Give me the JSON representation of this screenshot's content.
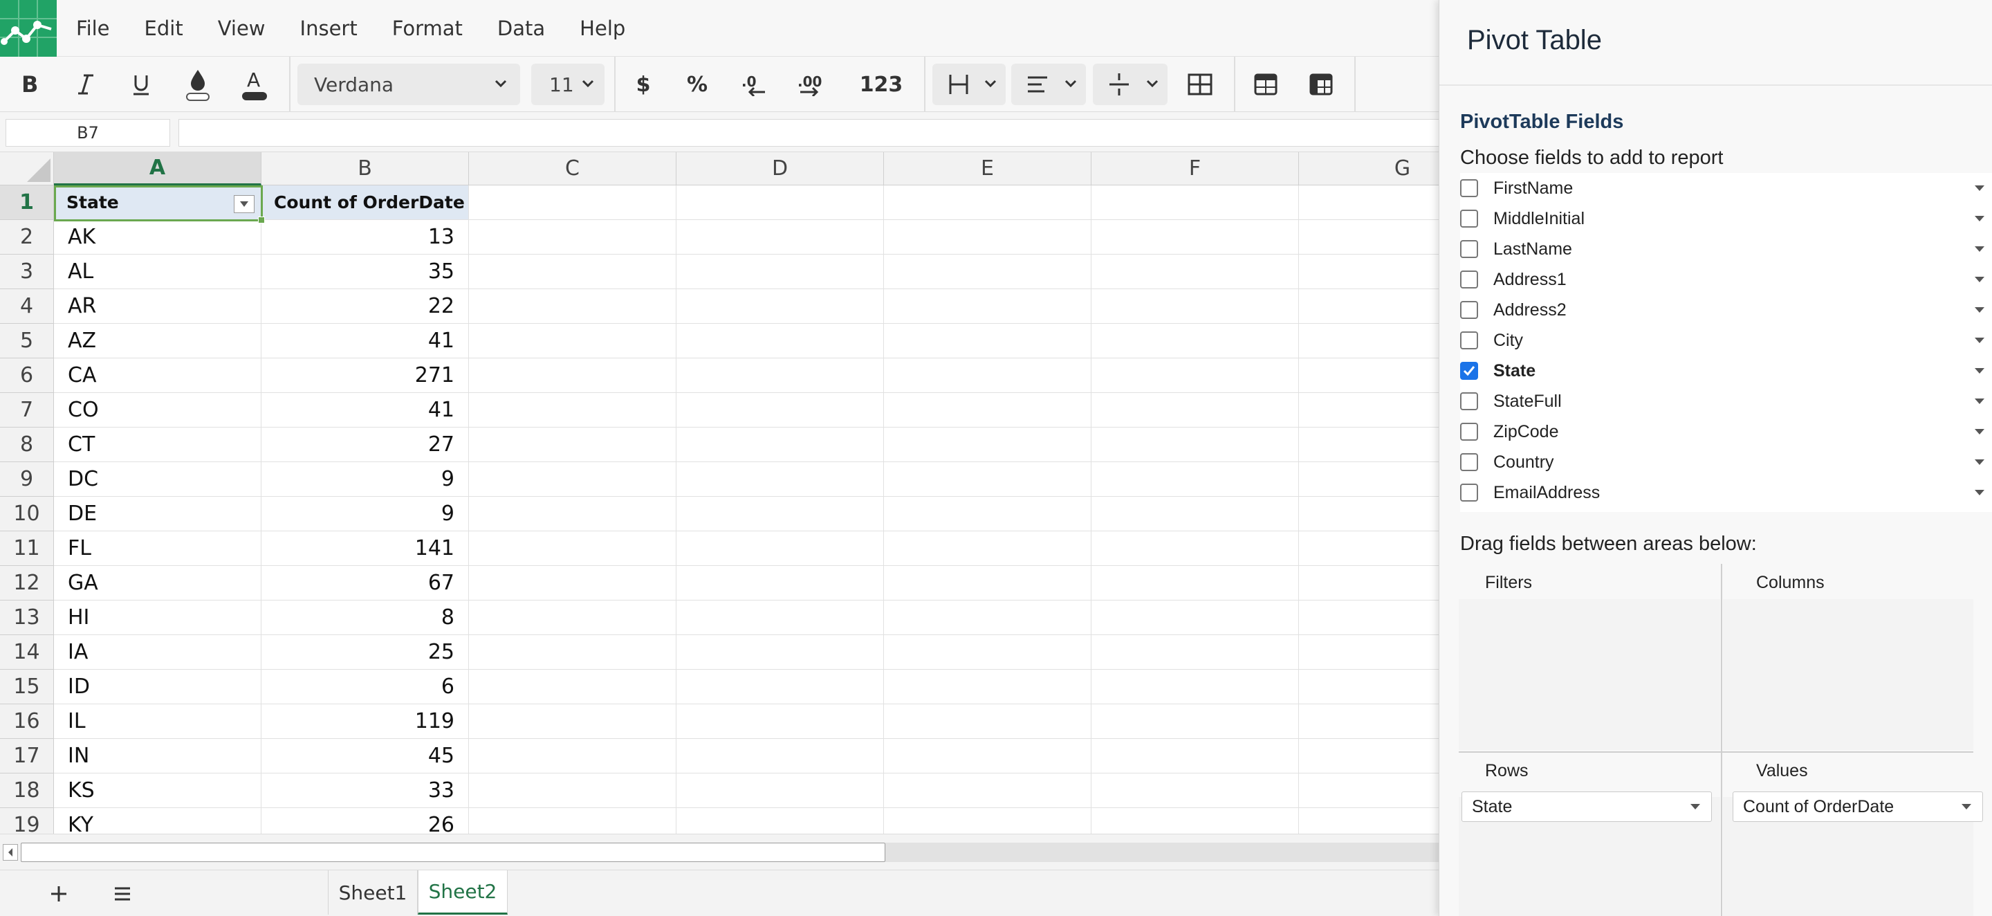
{
  "menu": {
    "items": [
      "File",
      "Edit",
      "View",
      "Insert",
      "Format",
      "Data",
      "Help"
    ]
  },
  "toolbar": {
    "font_name": "Verdana",
    "font_size": "11",
    "currency_label": "$",
    "percent_label": "%",
    "number_format_label": "123",
    "icons": [
      "bold-icon",
      "italic-icon",
      "underline-icon",
      "fill-color-icon",
      "text-color-icon",
      "decrease-decimal-icon",
      "increase-decimal-icon",
      "borders-icon",
      "align-icon",
      "vertical-align-icon",
      "merge-cells-icon",
      "table-icon",
      "pivot-table-icon"
    ]
  },
  "formula": {
    "cell_ref": "B7",
    "value": ""
  },
  "grid": {
    "columns": [
      "A",
      "B",
      "C",
      "D",
      "E",
      "F",
      "G"
    ],
    "active_column": "A",
    "active_row": "1",
    "rows": [
      {
        "n": "1",
        "a": "State",
        "b": "Count of OrderDate"
      },
      {
        "n": "2",
        "a": "AK",
        "b": "13"
      },
      {
        "n": "3",
        "a": "AL",
        "b": "35"
      },
      {
        "n": "4",
        "a": "AR",
        "b": "22"
      },
      {
        "n": "5",
        "a": "AZ",
        "b": "41"
      },
      {
        "n": "6",
        "a": "CA",
        "b": "271"
      },
      {
        "n": "7",
        "a": "CO",
        "b": "41"
      },
      {
        "n": "8",
        "a": "CT",
        "b": "27"
      },
      {
        "n": "9",
        "a": "DC",
        "b": "9"
      },
      {
        "n": "10",
        "a": "DE",
        "b": "9"
      },
      {
        "n": "11",
        "a": "FL",
        "b": "141"
      },
      {
        "n": "12",
        "a": "GA",
        "b": "67"
      },
      {
        "n": "13",
        "a": "HI",
        "b": "8"
      },
      {
        "n": "14",
        "a": "IA",
        "b": "25"
      },
      {
        "n": "15",
        "a": "ID",
        "b": "6"
      },
      {
        "n": "16",
        "a": "IL",
        "b": "119"
      },
      {
        "n": "17",
        "a": "IN",
        "b": "45"
      },
      {
        "n": "18",
        "a": "KS",
        "b": "33"
      },
      {
        "n": "19",
        "a": "KY",
        "b": "26"
      }
    ]
  },
  "sheets": {
    "tabs": [
      "Sheet1",
      "Sheet2"
    ],
    "active": "Sheet2"
  },
  "pivot": {
    "title": "Pivot Table",
    "fields_heading": "PivotTable Fields",
    "fields_subheading": "Choose fields to add to report",
    "fields": [
      {
        "label": "FirstName",
        "checked": false
      },
      {
        "label": "MiddleInitial",
        "checked": false
      },
      {
        "label": "LastName",
        "checked": false
      },
      {
        "label": "Address1",
        "checked": false
      },
      {
        "label": "Address2",
        "checked": false
      },
      {
        "label": "City",
        "checked": false
      },
      {
        "label": "State",
        "checked": true
      },
      {
        "label": "StateFull",
        "checked": false
      },
      {
        "label": "ZipCode",
        "checked": false
      },
      {
        "label": "Country",
        "checked": false
      },
      {
        "label": "EmailAddress",
        "checked": false
      }
    ],
    "drag_label": "Drag fields between areas below:",
    "areas": {
      "filters": {
        "title": "Filters",
        "items": []
      },
      "columns": {
        "title": "Columns",
        "items": []
      },
      "rows": {
        "title": "Rows",
        "items": [
          "State"
        ]
      },
      "values": {
        "title": "Values",
        "items": [
          "Count of OrderDate"
        ]
      }
    }
  },
  "colors": {
    "accent_green": "#217346",
    "brand_green": "#21a366",
    "checkbox_blue": "#1a73e8",
    "header_cell_bg": "#dfe8f3"
  }
}
